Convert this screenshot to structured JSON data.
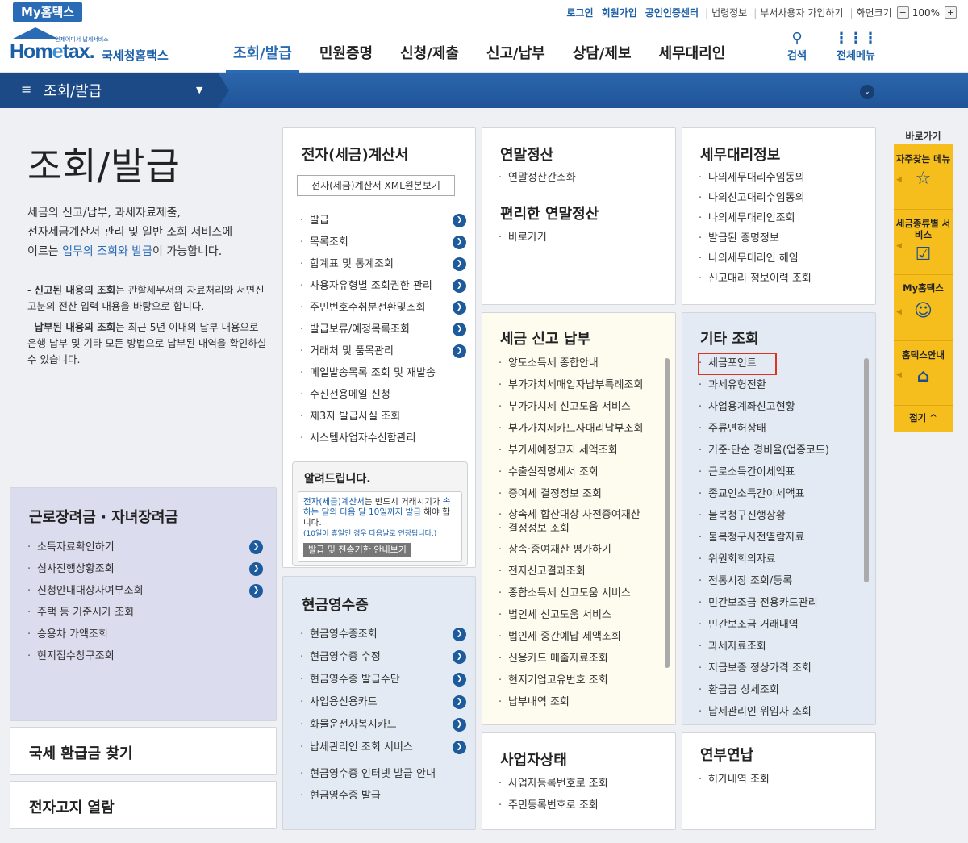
{
  "topbar": {
    "my_hometax": "My홈택스",
    "login": "로그인",
    "signup": "회원가입",
    "cert": "공인인증센터",
    "law": "법령정보",
    "dept_user": "부서사용자 가입하기",
    "screen_size": "화면크기",
    "zoom_minus": "−",
    "zoom_value": "100%",
    "zoom_plus": "+"
  },
  "logo": {
    "word_home": "Hom",
    "word_e": "e",
    "word_tax": "tax.",
    "small": "언제어디서 납세서비스",
    "kr": "국세청홈택스"
  },
  "nav": {
    "items": [
      "조회/발급",
      "민원증명",
      "신청/제출",
      "신고/납부",
      "상담/제보",
      "세무대리인"
    ],
    "active": 0,
    "search": "검색",
    "allmenu": "전체메뉴"
  },
  "bluebar": {
    "label": "조회/발급",
    "menu_icon": "≡",
    "caret": "▼",
    "circle": "⌄"
  },
  "page": {
    "title": "조회/발급",
    "intro_1": "세금의 신고/납부, 과세자료제출,",
    "intro_2": "전자세금계산서 관리 및 일반 조회 서비스에",
    "intro_3a": "이르는 ",
    "intro_3b": "업무의 조회와 발급",
    "intro_3c": "이 가능합니다.",
    "note1_b": "신고된 내용의 조회",
    "note1": "는 관할세무서의 자료처리와 서면신고분의 전산 입력 내용을 바탕으로 합니다.",
    "note2_b": "납부된 내용의 조회",
    "note2": "는 최근 5년 이내의 납부 내용으로 은행 납부 및 기타 모든 방법으로 납부된 내역을 확인하실 수 있습니다."
  },
  "einvoice": {
    "title": "전자(세금)계산서",
    "xml_button": "전자(세금)계산서 XML원본보기",
    "items": [
      "발급",
      "목록조회",
      "합계표 및 통계조회",
      "사용자유형별 조회권한 관리",
      "주민번호수취분전환및조회",
      "발급보류/예정목록조회",
      "거래처 및 품목관리",
      "메일발송목록 조회 및 재발송",
      "수신전용메일 신청",
      "제3자 발급사실 조회",
      "시스템사업자수신함관리"
    ],
    "notice_title": "알려드립니다.",
    "notice_1": "전자(세금)계산서",
    "notice_2": "는 반드시 거래시기가",
    "notice_3": "속하는 달의 다음 달 10일까지 발급",
    "notice_4": " 해야 합니다.",
    "notice_5": "(10일이 휴일인 경우 다음날로 연장됩니다.)",
    "notice_button": "발급 및 전송기한 안내보기"
  },
  "yearend": {
    "title": "연말정산",
    "items": [
      "연말정산간소화"
    ],
    "title2": "편리한 연말정산",
    "items2": [
      "바로가기"
    ]
  },
  "agent": {
    "title": "세무대리정보",
    "items": [
      "나의세무대리수임동의",
      "나의신고대리수임동의",
      "나의세무대리인조회",
      "발급된 증명정보",
      "나의세무대리인 해임",
      "신고대리 정보이력 조회"
    ]
  },
  "taxfile": {
    "title": "세금 신고 납부",
    "items": [
      "양도소득세 종합안내",
      "부가가치세매입자납부특례조회",
      "부가가치세 신고도움 서비스",
      "부가가치세카드사대리납부조회",
      "부가세예정고지 세액조회",
      "수출실적명세서 조회",
      "증여세 결정정보 조회",
      "상속세 합산대상 사전증여재산",
      "결정정보 조회",
      "상속·증여재산 평가하기",
      "전자신고결과조회",
      "종합소득세 신고도움 서비스",
      "법인세 신고도움 서비스",
      "법인세 중간예납 세액조회",
      "신용카드 매출자료조회",
      "현지기업고유번호 조회",
      "납부내역 조회"
    ]
  },
  "other": {
    "title": "기타 조회",
    "items": [
      "세금포인트",
      "과세유형전환",
      "사업용계좌신고현황",
      "주류면허상태",
      "기준·단순 경비율(업종코드)",
      "근로소득간이세액표",
      "종교인소득간이세액표",
      "불복청구진행상황",
      "불복청구사전열람자료",
      "위원회회의자료",
      "전통시장 조회/등록",
      "민간보조금 전용카드관리",
      "민간보조금 거래내역",
      "과세자료조회",
      "지급보증 정상가격 조회",
      "환급금 상세조회",
      "납세관리인 위임자 조회"
    ]
  },
  "labor": {
    "title": "근로장려금 · 자녀장려금",
    "items": [
      "소득자료확인하기",
      "심사진행상황조회",
      "신청안내대상자여부조회",
      "주택 등 기준시가 조회",
      "승용차 가액조회",
      "현지접수창구조회"
    ]
  },
  "refund": {
    "title": "국세 환급금 찾기"
  },
  "notice_bill": {
    "title": "전자고지 열람"
  },
  "cash": {
    "title": "현금영수증",
    "items": [
      "현금영수증조회",
      "현금영수증 수정",
      "현금영수증 발급수단",
      "사업용신용카드",
      "화물운전자복지카드",
      "납세관리인 조회 서비스",
      "현금영수증 인터넷 발급 안내",
      "현금영수증 발급"
    ]
  },
  "biz": {
    "title": "사업자상태",
    "items": [
      "사업자등록번호로 조회",
      "주민등록번호로 조회"
    ]
  },
  "delay": {
    "title": "연부연납",
    "items": [
      "허가내역 조회"
    ]
  },
  "quick": {
    "title": "바로가기",
    "fav": "자주찾는 메뉴",
    "bytype": "세금종류별 서비스",
    "my": "My홈택스",
    "guide": "홈택스안내",
    "collapse": "접기 ^"
  }
}
